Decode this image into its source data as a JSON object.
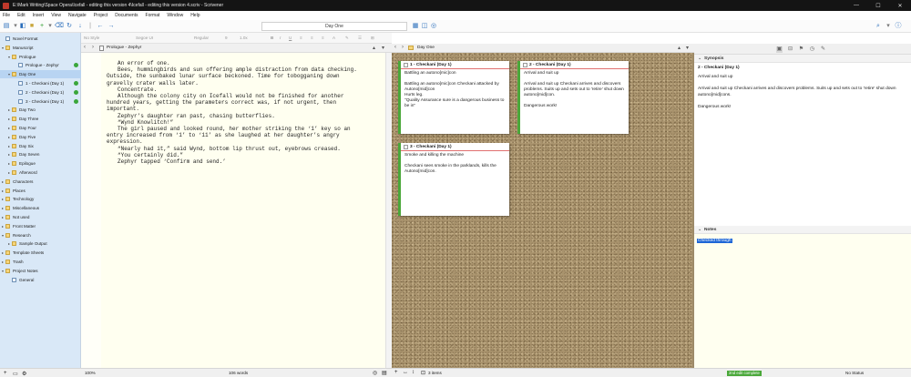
{
  "window": {
    "title": "E:\\Mark Writing\\Space Opera\\Icefall - editing this version 4\\Icefall - editing this version 4.scriv - Scrivener",
    "controls": [
      "—",
      "☐",
      "✕"
    ]
  },
  "menu": [
    "File",
    "Edit",
    "Insert",
    "View",
    "Navigate",
    "Project",
    "Documents",
    "Format",
    "Window",
    "Help"
  ],
  "toolbar": {
    "document_name": "Day One"
  },
  "binder": {
    "items": [
      {
        "label": "Novel Format",
        "level": 0,
        "twisty": "",
        "folder": false,
        "selected": false,
        "status": false
      },
      {
        "label": "Manuscript",
        "level": 0,
        "twisty": "▾",
        "folder": true,
        "selected": false,
        "status": false
      },
      {
        "label": "Prologue",
        "level": 1,
        "twisty": "▾",
        "folder": true,
        "selected": false,
        "status": false
      },
      {
        "label": "Prologue - Zephyr",
        "level": 2,
        "twisty": "",
        "folder": false,
        "selected": false,
        "status": true
      },
      {
        "label": "Day One",
        "level": 1,
        "twisty": "▾",
        "folder": true,
        "selected": true,
        "status": false
      },
      {
        "label": "1 - Checkani (Day 1)",
        "level": 2,
        "twisty": "",
        "folder": false,
        "selected": false,
        "status": true
      },
      {
        "label": "2 - Checkani (Day 1)",
        "level": 2,
        "twisty": "",
        "folder": false,
        "selected": false,
        "status": true
      },
      {
        "label": "3 - Checkani (Day 1)",
        "level": 2,
        "twisty": "",
        "folder": false,
        "selected": false,
        "status": true
      },
      {
        "label": "Day Two",
        "level": 1,
        "twisty": "▸",
        "folder": true,
        "selected": false,
        "status": false
      },
      {
        "label": "Day Three",
        "level": 1,
        "twisty": "▸",
        "folder": true,
        "selected": false,
        "status": false
      },
      {
        "label": "Day Four",
        "level": 1,
        "twisty": "▸",
        "folder": true,
        "selected": false,
        "status": false
      },
      {
        "label": "Day Five",
        "level": 1,
        "twisty": "▸",
        "folder": true,
        "selected": false,
        "status": false
      },
      {
        "label": "Day Six",
        "level": 1,
        "twisty": "▸",
        "folder": true,
        "selected": false,
        "status": false
      },
      {
        "label": "Day Seven",
        "level": 1,
        "twisty": "▸",
        "folder": true,
        "selected": false,
        "status": false
      },
      {
        "label": "Epilogue",
        "level": 1,
        "twisty": "▸",
        "folder": true,
        "selected": false,
        "status": false
      },
      {
        "label": "Afterword",
        "level": 1,
        "twisty": "▸",
        "folder": true,
        "selected": false,
        "status": false
      },
      {
        "label": "Characters",
        "level": 0,
        "twisty": "▸",
        "folder": true,
        "selected": false,
        "status": false
      },
      {
        "label": "Places",
        "level": 0,
        "twisty": "▸",
        "folder": true,
        "selected": false,
        "status": false
      },
      {
        "label": "Technology",
        "level": 0,
        "twisty": "▸",
        "folder": true,
        "selected": false,
        "status": false
      },
      {
        "label": "Miscellaneous",
        "level": 0,
        "twisty": "▸",
        "folder": true,
        "selected": false,
        "status": false
      },
      {
        "label": "Not used",
        "level": 0,
        "twisty": "▸",
        "folder": true,
        "selected": false,
        "status": false
      },
      {
        "label": "Front Matter",
        "level": 0,
        "twisty": "▸",
        "folder": true,
        "selected": false,
        "status": false
      },
      {
        "label": "Research",
        "level": 0,
        "twisty": "▾",
        "folder": true,
        "selected": false,
        "status": false
      },
      {
        "label": "Sample Output",
        "level": 1,
        "twisty": "▸",
        "folder": true,
        "selected": false,
        "status": false
      },
      {
        "label": "Template Sheets",
        "level": 0,
        "twisty": "▸",
        "folder": true,
        "selected": false,
        "status": false
      },
      {
        "label": "Trash",
        "level": 0,
        "twisty": "▸",
        "folder": true,
        "selected": false,
        "status": false
      },
      {
        "label": "Project Notes",
        "level": 0,
        "twisty": "▾",
        "folder": true,
        "selected": false,
        "status": false
      },
      {
        "label": "General",
        "level": 1,
        "twisty": "",
        "folder": false,
        "selected": false,
        "status": false
      }
    ]
  },
  "format_bar": {
    "style": "No Style",
    "font": "Segoe UI",
    "weight": "Regular",
    "size": "9",
    "spacing": "1.0x"
  },
  "editor": {
    "header_title": "Prologue - Zephyr",
    "paragraphs": [
      "An error of one.",
      "Bees, hummingbirds and sun offering ample distraction from data checking. Outside, the sunbaked lunar surface beckoned. Time for tobogganing down gravelly crater walls later.",
      "Concentrate.",
      "Although the colony city on Icefall would not be finished for another hundred years, getting the parameters correct was, if not urgent, then important.",
      "Zephyr’s daughter ran past, chasing butterflies.",
      "“Wynd Knowlitch!”",
      "The girl paused and looked round, her mother striking the ‘1’ key so an entry increased from ‘1’ to ‘11’ as she laughed at her daughter’s angry expression.",
      "“Nearly had it,” said Wynd, bottom lip thrust out, eyebrows creased.",
      "“You certainly did.”",
      "Zephyr tapped ‘Confirm and send.’"
    ],
    "zoom": "100%",
    "word_count": "106 words"
  },
  "corkboard": {
    "header_title": "Day One",
    "cards": [
      {
        "title": "1 - Checkani (Day 1)",
        "synopsis": "Battling an autono[mic]con\n\nBattling an autono[mic]con Checkani attacked by Autono[mid]con\nHurts leg.\n\"Quality Assurance sure is a dangerous business to be in\""
      },
      {
        "title": "2 - Checkani (Day 1)",
        "synopsis": "Arrival and suit up\n\nArrival and suit up Checkani arrives and discovers problems. Suits up and sets out to 'retire' shut down autono[mid]con.\n\nDangerous work!"
      },
      {
        "title": "3 - Checkani (Day 1)",
        "synopsis": "Smoke and killing the machine\n\nCheckani sees smoke in the parklands, kills the Autono[mid]con."
      }
    ],
    "item_count": "3 items"
  },
  "inspector": {
    "synopsis_header": "Synopsis",
    "synopsis_title": "2 - Checkani (Day 1)",
    "synopsis_body": "Arrival and suit up\n\nArrival and suit up Checkani arrives and discovers problems. Suits up and sets out to 'retire' shut down autono[mid]cons.\n\nDangerous work!",
    "notes_header": "Notes",
    "notes_text": "Checked through",
    "status_label": "2nd edit complete",
    "status_value": "No Status"
  },
  "colors": {
    "binder_bg": "#d9e8f7",
    "editor_bg": "#fffff0",
    "status_green": "#3aa63a",
    "selection_blue": "#1e66d6",
    "card_title_rule": "#e07070"
  }
}
